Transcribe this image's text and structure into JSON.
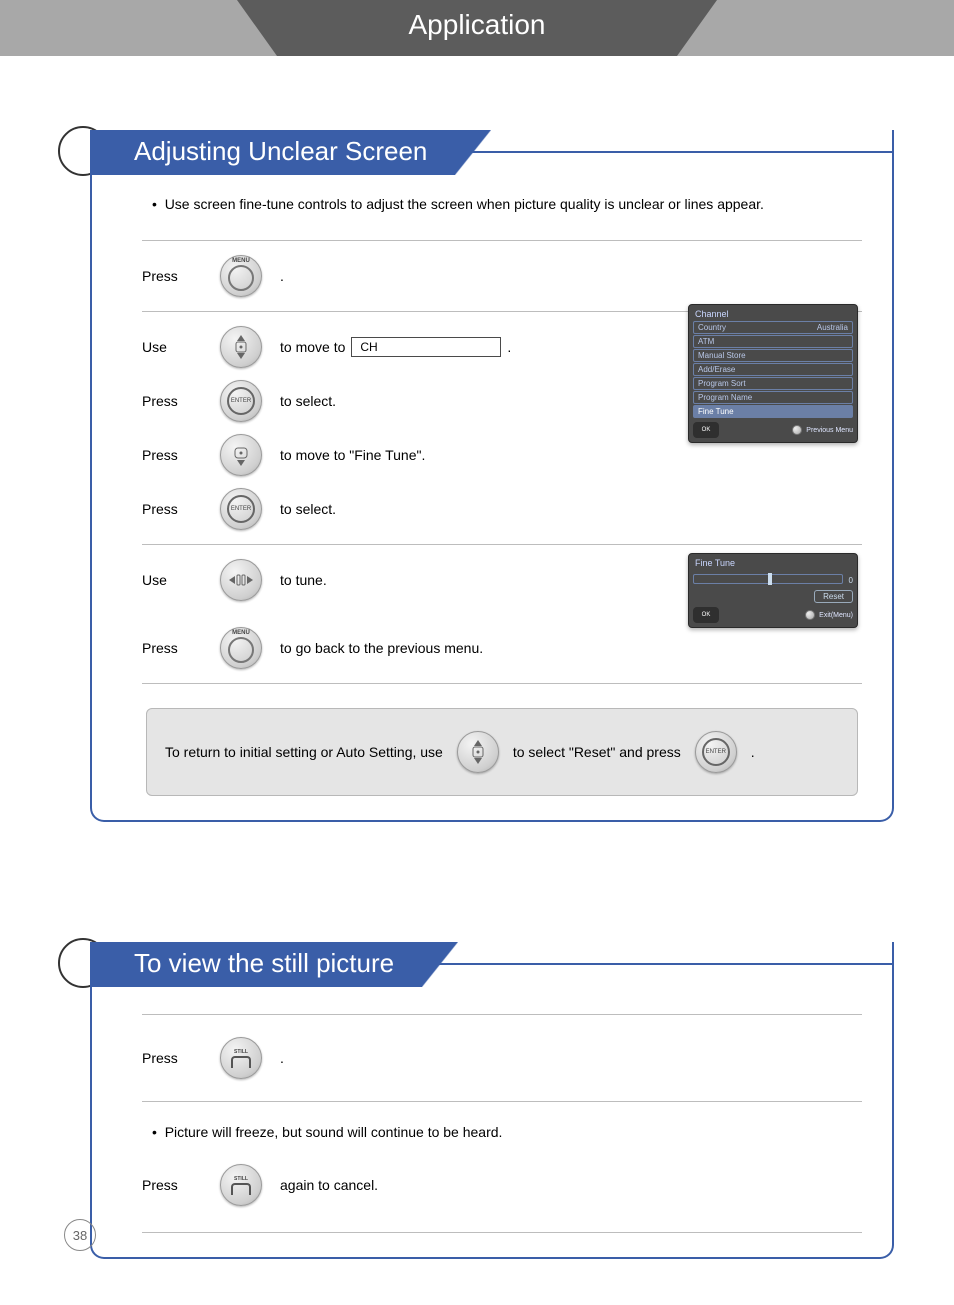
{
  "header": {
    "title": "Application"
  },
  "section1": {
    "title": "Adjusting Unclear Screen",
    "intro": "Use screen fine-tune controls to adjust the screen when picture quality is unclear or lines appear.",
    "steps": {
      "s1": {
        "verb": "Press",
        "btn_label": "MENU",
        "desc": "."
      },
      "s2": {
        "verb": "Use",
        "desc_pre": "to move to ",
        "field": "CH",
        "desc_post": "."
      },
      "s3": {
        "verb": "Press",
        "btn_label": "ENTER",
        "desc": "to select."
      },
      "s4": {
        "verb": "Press",
        "desc": "to move to \"Fine Tune\"."
      },
      "s5": {
        "verb": "Press",
        "btn_label": "ENTER",
        "desc": "to select."
      },
      "s6": {
        "verb": "Use",
        "desc": "to tune."
      },
      "s7": {
        "verb": "Press",
        "btn_label": "MENU",
        "desc": "to go back to the previous menu."
      }
    },
    "osd_channel": {
      "title": "Channel",
      "rows": [
        {
          "label": "Country",
          "value": "Australia"
        },
        {
          "label": "ATM",
          "value": ""
        },
        {
          "label": "Manual Store",
          "value": ""
        },
        {
          "label": "Add/Erase",
          "value": ""
        },
        {
          "label": "Program Sort",
          "value": ""
        },
        {
          "label": "Program Name",
          "value": ""
        },
        {
          "label": "Fine Tune",
          "value": "",
          "active": true
        }
      ],
      "nav_center": "OK",
      "footer": "Previous Menu"
    },
    "osd_fine": {
      "title": "Fine Tune",
      "value": "0",
      "reset": "Reset",
      "nav_center": "OK",
      "footer": "Exit(Menu)"
    },
    "hint": {
      "pre": "To return to initial setting or Auto Setting, use",
      "mid": "to select \"Reset\" and press",
      "post": "."
    }
  },
  "section2": {
    "title": "To view the still picture",
    "steps": {
      "s1": {
        "verb": "Press",
        "btn_label": "STILL",
        "desc": "."
      },
      "note": "Picture will freeze, but sound will continue to be heard.",
      "s2": {
        "verb": "Press",
        "btn_label": "STILL",
        "desc": "again to cancel."
      }
    }
  },
  "page_number": "38"
}
